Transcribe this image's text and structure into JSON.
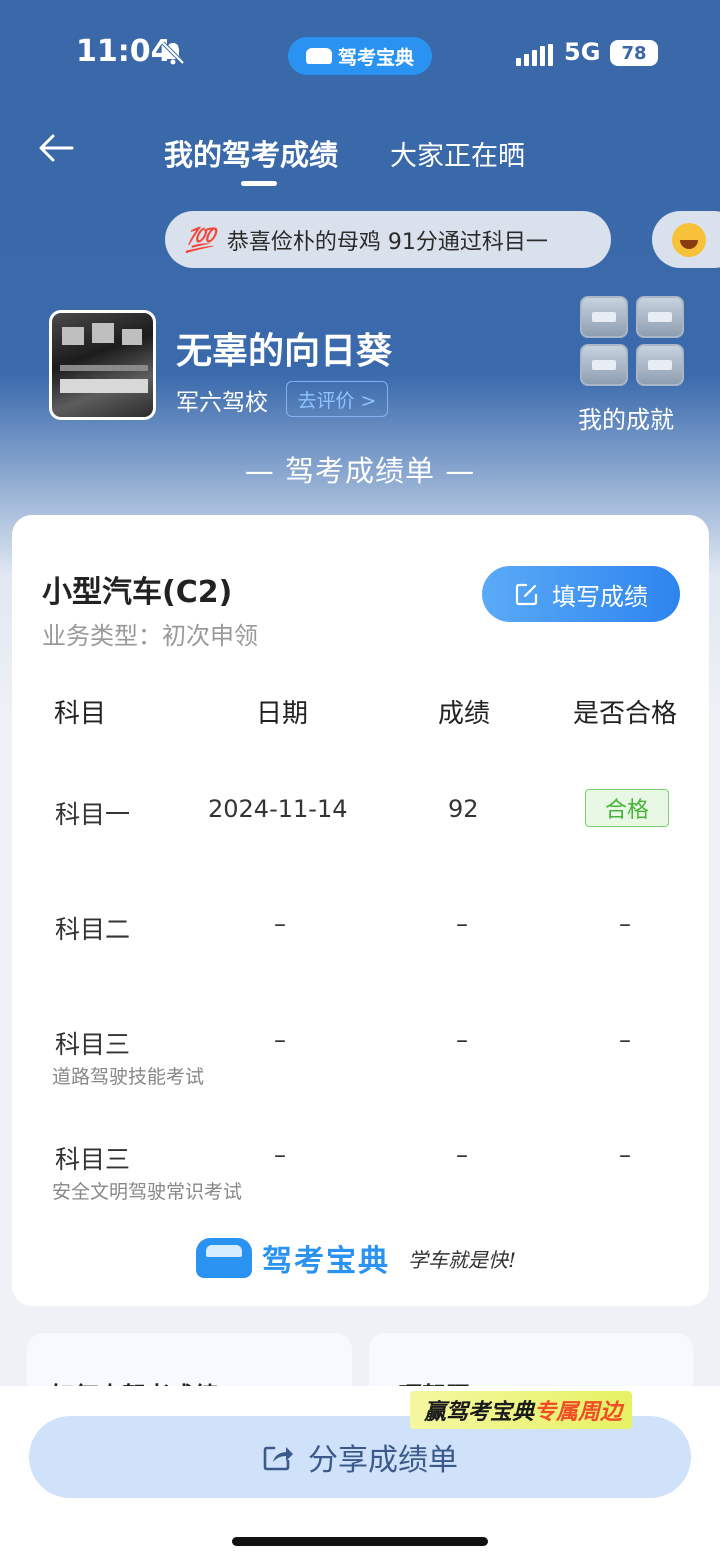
{
  "status_bar": {
    "time": "11:04",
    "app_badge": "驾考宝典",
    "network": "5G",
    "battery": "78"
  },
  "nav": {
    "back_icon": "back-arrow-icon",
    "tab_active": "我的驾考成绩",
    "tab_other": "大家正在晒"
  },
  "marquee": {
    "icon": "💯",
    "text": "恭喜俭朴的母鸡 91分通过科目一"
  },
  "profile": {
    "name": "无辜的向日葵",
    "school": "军六驾校",
    "rate_label": "去评价 >",
    "achievements_label": "我的成就"
  },
  "sheet_title": "— 驾考成绩单 —",
  "card": {
    "car_type": "小型汽车(C2)",
    "business_type": "业务类型：初次申领",
    "fill_button": "填写成绩",
    "headers": [
      "科目",
      "日期",
      "成绩",
      "是否合格"
    ],
    "rows": [
      {
        "subject": "科目一",
        "note": "",
        "date": "2024-11-14",
        "score": "92",
        "result": "合格"
      },
      {
        "subject": "科目二",
        "note": "",
        "date": "–",
        "score": "–",
        "result": "–"
      },
      {
        "subject": "科目三",
        "note": "道路驾驶技能考试",
        "date": "–",
        "score": "–",
        "result": "–"
      },
      {
        "subject": "科目三",
        "note": "安全文明驾驶常识考试",
        "date": "–",
        "score": "–",
        "result": "–"
      }
    ],
    "brand": "驾考宝典",
    "slogan": "学车就是快!"
  },
  "lower_cards": {
    "left_text": "如何查驾考成绩",
    "right_text": "晒驾照"
  },
  "promo": {
    "part1": "赢驾考宝典",
    "part2": "专属周边"
  },
  "share_button": "分享成绩单",
  "colors": {
    "header_blue": "#3a68a8",
    "accent_blue": "#2a93f1",
    "pass_green": "#49b43b"
  }
}
